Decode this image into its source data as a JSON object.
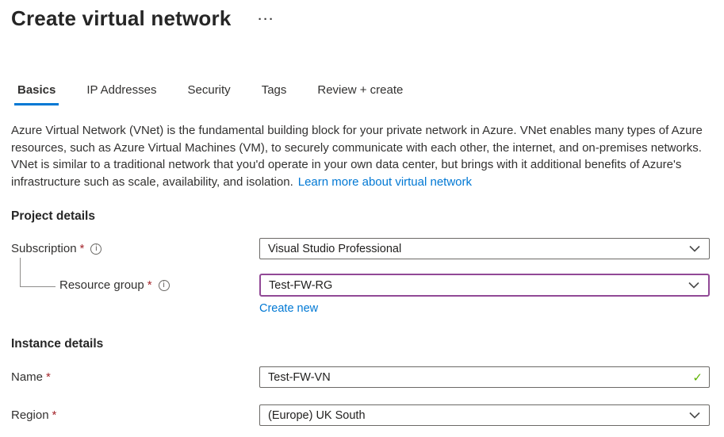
{
  "header": {
    "title": "Create virtual network",
    "more_options_glyph": "···"
  },
  "tabs": [
    {
      "label": "Basics",
      "active": true
    },
    {
      "label": "IP Addresses",
      "active": false
    },
    {
      "label": "Security",
      "active": false
    },
    {
      "label": "Tags",
      "active": false
    },
    {
      "label": "Review + create",
      "active": false
    }
  ],
  "intro": {
    "text": "Azure Virtual Network (VNet) is the fundamental building block for your private network in Azure. VNet enables many types of Azure resources, such as Azure Virtual Machines (VM), to securely communicate with each other, the internet, and on-premises networks. VNet is similar to a traditional network that you'd operate in your own data center, but brings with it additional benefits of Azure's infrastructure such as scale, availability, and isolation.",
    "learn_more_label": "Learn more about virtual network"
  },
  "project_details": {
    "heading": "Project details",
    "subscription": {
      "label": "Subscription",
      "value": "Visual Studio Professional"
    },
    "resource_group": {
      "label": "Resource group",
      "value": "Test-FW-RG",
      "create_new_label": "Create new"
    }
  },
  "instance_details": {
    "heading": "Instance details",
    "name": {
      "label": "Name",
      "value": "Test-FW-VN"
    },
    "region": {
      "label": "Region",
      "value": "(Europe) UK South"
    }
  },
  "glyphs": {
    "required_marker": "*",
    "info": "i",
    "check": "✓"
  },
  "colors": {
    "accent_blue": "#0078d4",
    "required_red": "#a4262c",
    "focus_purple": "#914996",
    "valid_green": "#5db300"
  }
}
